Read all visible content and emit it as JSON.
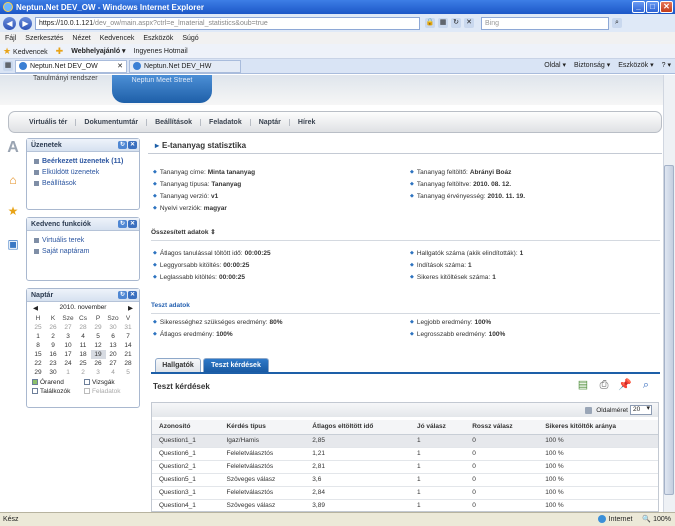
{
  "window": {
    "title": "Neptun.Net DEV_OW - Windows Internet Explorer"
  },
  "browser": {
    "url_main": "https://10.0.1.121",
    "url_rest": "/dev_ow/main.aspx?ctrl=e_lmaterial_statistics&oub=true",
    "search_placeholder": "Bing",
    "menu": [
      "Fájl",
      "Szerkesztés",
      "Nézet",
      "Kedvencek",
      "Eszközök",
      "Súgó"
    ],
    "favorites_label": "Kedvencek",
    "fav_links": [
      "Webhelyajánló ▾",
      "Ingyenes Hotmail"
    ],
    "tabs": [
      "Neptun.Net DEV_OW",
      "Neptun.Net DEV_HW"
    ],
    "commands": [
      "Oldal ▾",
      "Biztonság ▾",
      "Eszközök ▾",
      "? ▾"
    ],
    "status_left": "Kész",
    "status_zone": "Internet",
    "zoom": "100%"
  },
  "banner": {
    "brand": "Neptun Meet Street",
    "subtitle": "Tanulmányi rendszer"
  },
  "main_menu": [
    "Virtuális tér",
    "Dokumentumtár",
    "Beállítások",
    "Feladatok",
    "Naptár",
    "Hírek"
  ],
  "messages_widget": {
    "title": "Üzenetek",
    "items": [
      "Beérkezett üzenetek (11)",
      "Elküldött üzenetek",
      "Beállítások"
    ]
  },
  "favorites_widget": {
    "title": "Kedvenc funkciók",
    "items": [
      "Virtuális terek",
      "Saját naptáram"
    ]
  },
  "calendar": {
    "title": "Naptár",
    "month": "2010. november",
    "days": [
      "H",
      "K",
      "Sze",
      "Cs",
      "P",
      "Szo",
      "V"
    ],
    "weeks": [
      [
        "25",
        "26",
        "27",
        "28",
        "29",
        "30",
        "31"
      ],
      [
        "1",
        "2",
        "3",
        "4",
        "5",
        "6",
        "7"
      ],
      [
        "8",
        "9",
        "10",
        "11",
        "12",
        "13",
        "14"
      ],
      [
        "15",
        "16",
        "17",
        "18",
        "19",
        "20",
        "21"
      ],
      [
        "22",
        "23",
        "24",
        "25",
        "26",
        "27",
        "28"
      ],
      [
        "29",
        "30",
        "1",
        "2",
        "3",
        "4",
        "5"
      ]
    ],
    "legend": [
      "Órarend",
      "Vizsgák",
      "Találkozók",
      "Feladatok"
    ]
  },
  "panel": {
    "title": "E-tananyag statisztika",
    "left_fields": [
      {
        "label": "Tananyag címe:",
        "value": "Minta tananyag"
      },
      {
        "label": "Tananyag típusa:",
        "value": "Tananyag"
      },
      {
        "label": "Tananyag verzió:",
        "value": "v1"
      },
      {
        "label": "Nyelvi verziók:",
        "value": "magyar"
      }
    ],
    "right_fields": [
      {
        "label": "Tananyag feltöltő:",
        "value": "Abrányi Boáz"
      },
      {
        "label": "Tananyag feltöltve:",
        "value": "2010. 08. 12."
      },
      {
        "label": "Tananyag érvényesség:",
        "value": "2010. 11. 19."
      }
    ],
    "summary_title": "Összesített adatok",
    "summary_left": [
      {
        "label": "Átlagos tanulással töltött idő:",
        "value": "00:00:25"
      },
      {
        "label": "Leggyorsabb kitöltés:",
        "value": "00:00:25"
      },
      {
        "label": "Leglassabb kitöltés:",
        "value": "00:00:25"
      }
    ],
    "summary_right": [
      {
        "label": "Hallgatók száma (akik elindították):",
        "value": "1"
      },
      {
        "label": "Indítások száma:",
        "value": "1"
      },
      {
        "label": "Sikeres kitöltések száma:",
        "value": "1"
      }
    ],
    "test_title": "Teszt adatok",
    "test_left": [
      {
        "label": "Sikerességhez szükséges eredmény:",
        "value": "80%"
      },
      {
        "label": "Átlagos eredmény:",
        "value": "100%"
      }
    ],
    "test_right": [
      {
        "label": "Legjobb eredmény:",
        "value": "100%"
      },
      {
        "label": "Legrosszabb eredmény:",
        "value": "100%"
      }
    ],
    "tabs": [
      "Hallgatók",
      "Teszt kérdések"
    ],
    "grid_title": "Teszt kérdések",
    "page_size_label": "Oldalméret",
    "page_size": "20",
    "columns": [
      "Azonosító",
      "Kérdés típus",
      "Átlagos eltöltött idő",
      "Jó válasz",
      "Rossz válasz",
      "Sikeres kitöltők aránya"
    ],
    "rows": [
      [
        "Question1_1",
        "Igaz/Hamis",
        "2,85",
        "1",
        "0",
        "100 %"
      ],
      [
        "Question6_1",
        "Feleletválasztós",
        "1,21",
        "1",
        "0",
        "100 %"
      ],
      [
        "Question2_1",
        "Feleletválasztós",
        "2,81",
        "1",
        "0",
        "100 %"
      ],
      [
        "Question5_1",
        "Szöveges válasz",
        "3,6",
        "1",
        "0",
        "100 %"
      ],
      [
        "Question3_1",
        "Feleletválasztós",
        "2,84",
        "1",
        "0",
        "100 %"
      ],
      [
        "Question4_1",
        "Szöveges válasz",
        "3,89",
        "1",
        "0",
        "100 %"
      ]
    ]
  }
}
